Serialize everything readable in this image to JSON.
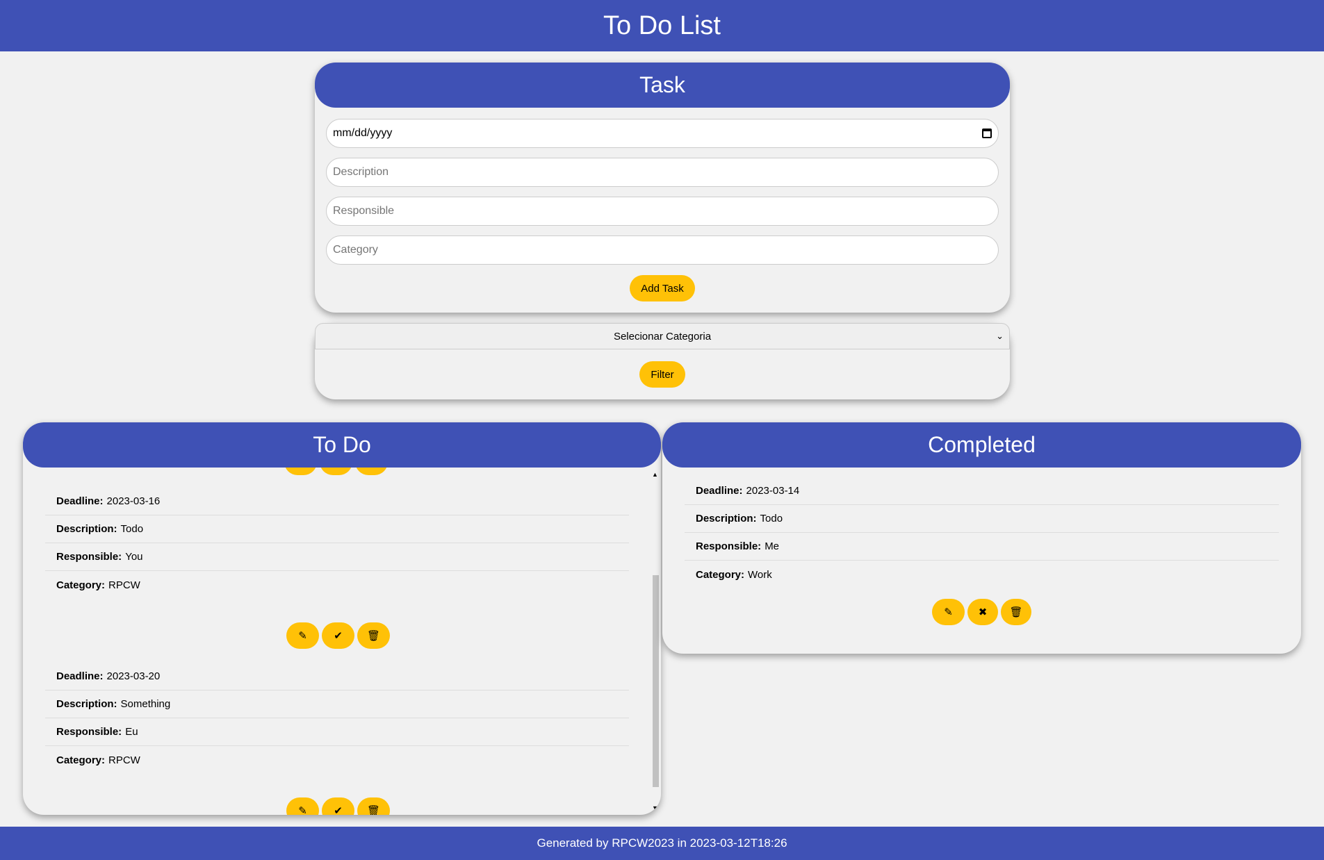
{
  "header": {
    "title": "To Do List"
  },
  "task_form": {
    "title": "Task",
    "date_value": "mm/dd/yyyy",
    "description_placeholder": "Description",
    "responsible_placeholder": "Responsible",
    "category_placeholder": "Category",
    "add_label": "Add Task"
  },
  "filter": {
    "selected": "Selecionar Categoria",
    "button_label": "Filter"
  },
  "todo": {
    "title": "To Do",
    "labels": {
      "deadline": "Deadline:",
      "description": "Description:",
      "responsible": "Responsible:",
      "category": "Category:"
    },
    "items": [
      {
        "deadline": "2023-03-16",
        "description": "Todo",
        "responsible": "You",
        "category": "RPCW"
      },
      {
        "deadline": "2023-03-20",
        "description": "Something",
        "responsible": "Eu",
        "category": "RPCW"
      }
    ]
  },
  "completed": {
    "title": "Completed",
    "items": [
      {
        "deadline": "2023-03-14",
        "description": "Todo",
        "responsible": "Me",
        "category": "Work"
      }
    ]
  },
  "icons": {
    "edit": "edit-icon",
    "check": "check-icon",
    "undo": "close-icon",
    "delete": "trash-icon"
  },
  "colors": {
    "primary": "#3f51b5",
    "accent": "#ffc107",
    "background": "#f1f1f1"
  },
  "footer": {
    "text": "Generated by RPCW2023 in 2023-03-12T18:26"
  }
}
